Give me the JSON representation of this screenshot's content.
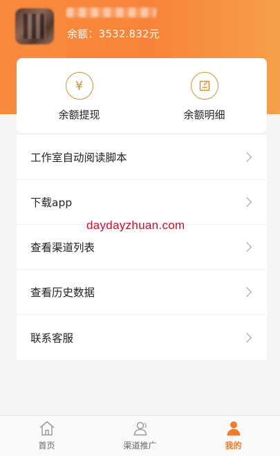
{
  "header": {
    "balance_text": "余额：3532.832元"
  },
  "actions": {
    "withdraw": {
      "label": "余额提现",
      "icon": "yen-icon",
      "glyph": "¥"
    },
    "details": {
      "label": "余额明细",
      "icon": "edit-note-icon"
    }
  },
  "menu": {
    "items": [
      {
        "label": "工作室自动阅读脚本"
      },
      {
        "label": "下载app"
      },
      {
        "label": "查看渠道列表"
      },
      {
        "label": "查看历史数据"
      },
      {
        "label": "联系客服"
      }
    ]
  },
  "watermark": "daydayzhuan.com",
  "tabbar": {
    "tabs": [
      {
        "label": "首页",
        "icon": "home-icon"
      },
      {
        "label": "渠道推广",
        "icon": "users-icon"
      },
      {
        "label": "我的",
        "icon": "person-icon",
        "active": true
      }
    ]
  },
  "colors": {
    "accent": "#f7843a",
    "gold": "#d28f2c",
    "active_tab": "#f27b2b"
  }
}
